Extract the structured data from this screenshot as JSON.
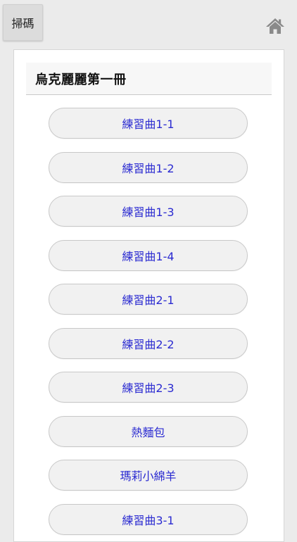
{
  "topbar": {
    "scan_label": "掃碼",
    "home_icon": "home-icon",
    "icon_color": "#8a8a8a"
  },
  "card": {
    "title": "烏克麗麗第一冊"
  },
  "list": {
    "items": [
      {
        "label": "練習曲1-1"
      },
      {
        "label": "練習曲1-2"
      },
      {
        "label": "練習曲1-3"
      },
      {
        "label": "練習曲1-4"
      },
      {
        "label": "練習曲2-1"
      },
      {
        "label": "練習曲2-2"
      },
      {
        "label": "練習曲2-3"
      },
      {
        "label": "熱麵包"
      },
      {
        "label": "瑪莉小綿羊"
      },
      {
        "label": "練習曲3-1"
      }
    ],
    "link_color": "#2b2bd1"
  }
}
